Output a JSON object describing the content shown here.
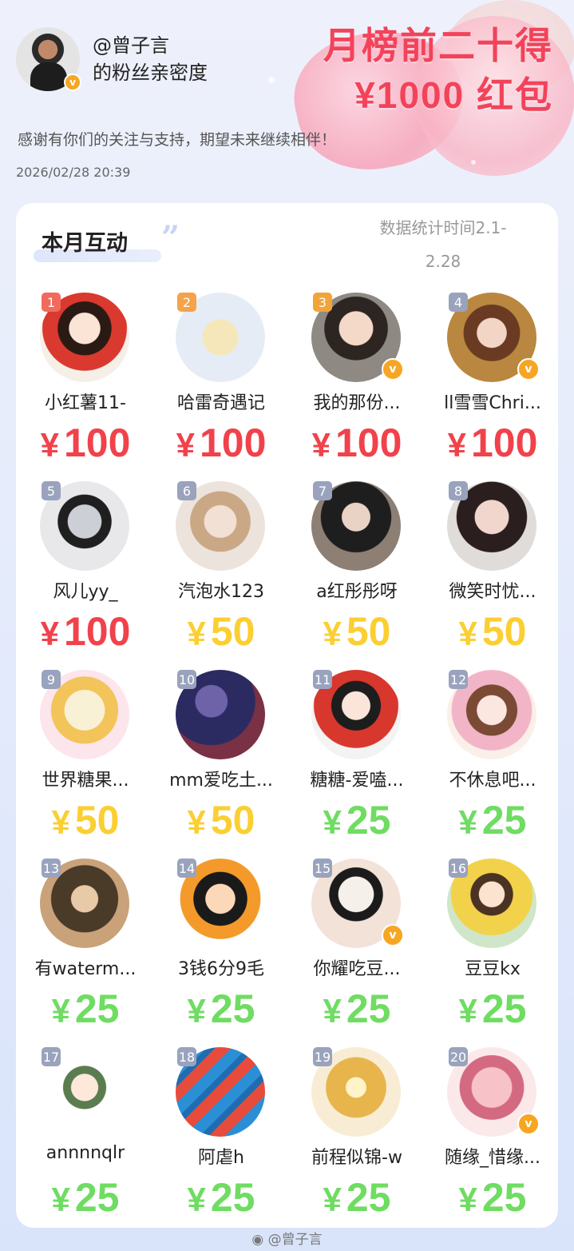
{
  "header": {
    "handle": "@曾子言",
    "subtitle": "的粉丝亲密度",
    "promo_line1": "月榜前二十得",
    "promo_line2": "¥1000 红包",
    "thanks": "感谢有你们的关注与支持，期望未来继续相伴！",
    "datetime": "2026/02/28  20:39"
  },
  "card": {
    "title": "本月互动",
    "stat_line1": "数据统计时间2.1-",
    "stat_line2": "2.28"
  },
  "colors": {
    "red": "#f1424b",
    "yellow": "#fbcf32",
    "green": "#6fdc62",
    "rank_top": "#f26a5c",
    "rank_second": "#f5a24b",
    "rank_third": "#f2a43a",
    "rank_default": "#9aa3bd"
  },
  "currency": "¥",
  "fans": [
    {
      "rank": "1",
      "name": "小红薯11-",
      "amount": "100"
    },
    {
      "rank": "2",
      "name": "哈雷奇遇记",
      "amount": "100"
    },
    {
      "rank": "3",
      "name": "我的那份...",
      "amount": "100"
    },
    {
      "rank": "4",
      "name": "ll雪雪Chri...",
      "amount": "100"
    },
    {
      "rank": "5",
      "name": "风儿yy_",
      "amount": "100"
    },
    {
      "rank": "6",
      "name": "汽泡水123",
      "amount": "50"
    },
    {
      "rank": "7",
      "name": "a红彤彤呀",
      "amount": "50"
    },
    {
      "rank": "8",
      "name": "微笑时忧...",
      "amount": "50"
    },
    {
      "rank": "9",
      "name": "世界糖果...",
      "amount": "50"
    },
    {
      "rank": "10",
      "name": "mm爱吃土...",
      "amount": "50"
    },
    {
      "rank": "11",
      "name": "糖糖-爱嗑...",
      "amount": "25"
    },
    {
      "rank": "12",
      "name": "不休息吧...",
      "amount": "25"
    },
    {
      "rank": "13",
      "name": "有waterm...",
      "amount": "25"
    },
    {
      "rank": "14",
      "name": "3钱6分9毛",
      "amount": "25"
    },
    {
      "rank": "15",
      "name": "你耀吃豆...",
      "amount": "25"
    },
    {
      "rank": "16",
      "name": "豆豆kx",
      "amount": "25"
    },
    {
      "rank": "17",
      "name": "annnnqlr",
      "amount": "25"
    },
    {
      "rank": "18",
      "name": "阿虐h",
      "amount": "25"
    },
    {
      "rank": "19",
      "name": "前程似锦-w",
      "amount": "25"
    },
    {
      "rank": "20",
      "name": "随缘_惜缘...",
      "amount": "25"
    }
  ],
  "footer": "@曾子言"
}
